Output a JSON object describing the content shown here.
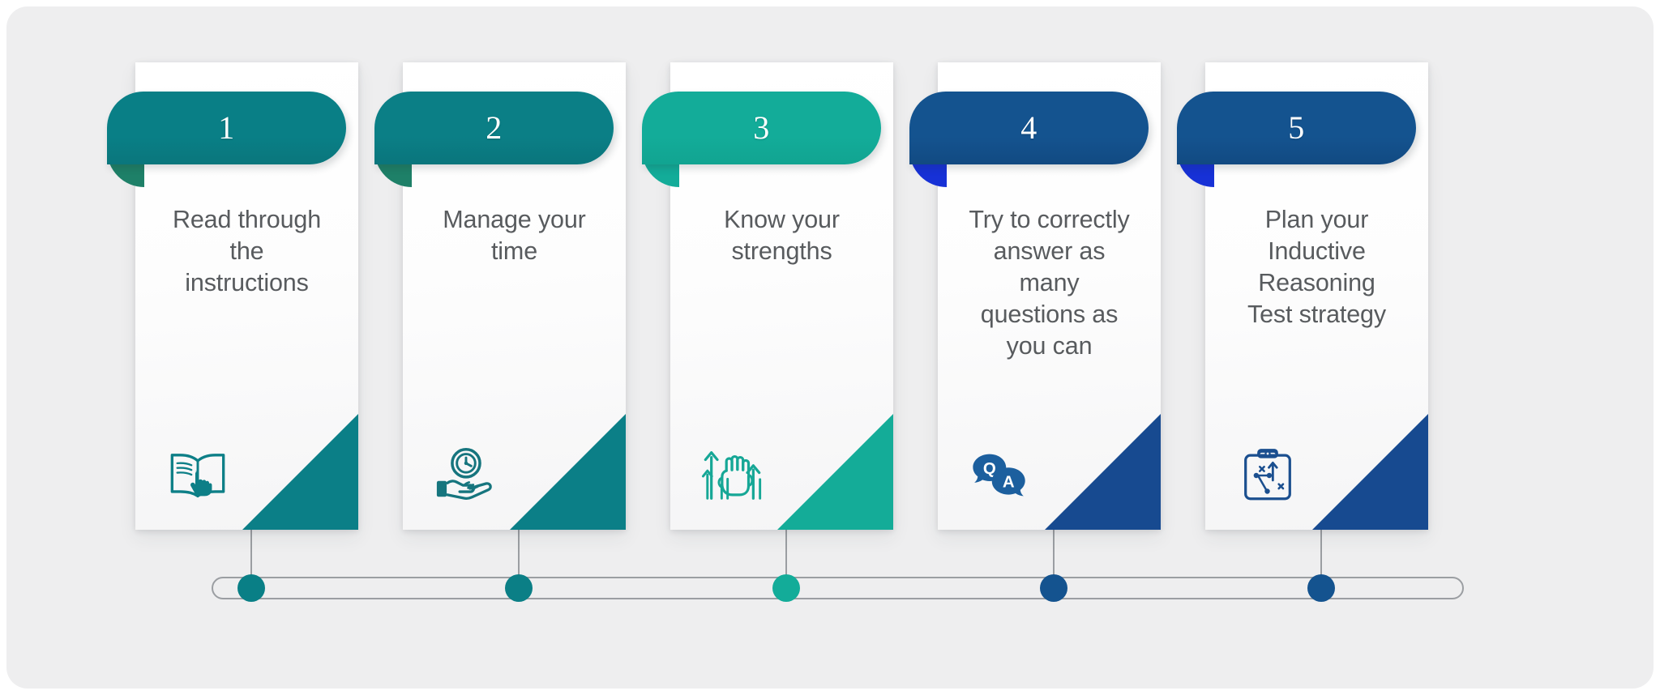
{
  "infographic": {
    "background_color": "#eeeeef",
    "timeline": {
      "track_color": "#9b9ea2",
      "label": "progress-timeline"
    },
    "steps": [
      {
        "number": "1",
        "title": "Read through\nthe\ninstructions",
        "icon": "open-book-with-pointing-hand-icon",
        "ribbon_color": "#097f86",
        "ribbon_color_dark": "#0a767c",
        "fold_color": "#1e8068",
        "corner_color": "#0b7f87",
        "node_color": "#097f86",
        "icon_color": "#0d7f87"
      },
      {
        "number": "2",
        "title": "Manage your\ntime",
        "icon": "hand-holding-clock-icon",
        "ribbon_color": "#0b7f86",
        "ribbon_color_dark": "#0a757c",
        "fold_color": "#1e8068",
        "corner_color": "#0b7f87",
        "node_color": "#0b7f86",
        "icon_color": "#16757e"
      },
      {
        "number": "3",
        "title": "Know your\nstrengths",
        "icon": "raised-fist-with-up-arrows-icon",
        "ribbon_color": "#13ac99",
        "ribbon_color_dark": "#11a491",
        "fold_color": "#13ac99",
        "corner_color": "#14ac98",
        "node_color": "#13ac99",
        "icon_color": "#16a796"
      },
      {
        "number": "4",
        "title": "Try to correctly\nanswer as\nmany\nquestions as\nyou can",
        "icon": "question-answer-speech-bubbles-icon",
        "ribbon_color": "#14538f",
        "ribbon_color_dark": "#124a82",
        "fold_color": "#1731d6",
        "corner_color": "#174a90",
        "node_color": "#14538f",
        "icon_color": "#1c5f9e"
      },
      {
        "number": "5",
        "title": "Plan your\nInductive\nReasoning\nTest strategy",
        "icon": "clipboard-strategy-plan-icon",
        "ribbon_color": "#14538f",
        "ribbon_color_dark": "#124a82",
        "fold_color": "#1731d6",
        "corner_color": "#174a90",
        "node_color": "#14538f",
        "icon_color": "#1b4f8f"
      }
    ]
  }
}
